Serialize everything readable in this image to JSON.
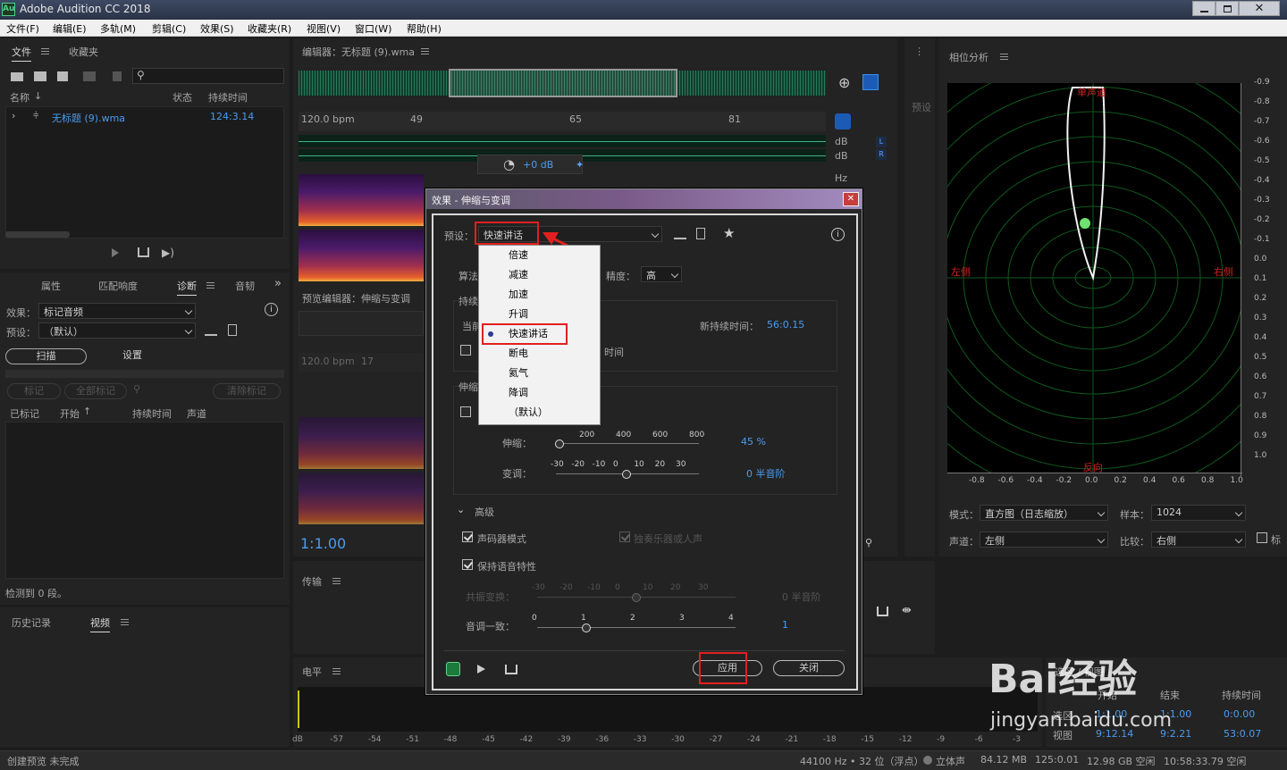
{
  "app": {
    "icon_text": "Au",
    "title": "Adobe Audition CC 2018"
  },
  "menu": [
    "文件(F)",
    "编辑(E)",
    "多轨(M)",
    "剪辑(C)",
    "效果(S)",
    "收藏夹(R)",
    "视图(V)",
    "窗口(W)",
    "帮助(H)"
  ],
  "files_panel": {
    "tab_files": "文件",
    "tab_favorites": "收藏夹",
    "col_name": "名称",
    "col_status": "状态",
    "col_duration": "持续时间",
    "file_name": "无标题 (9).wma",
    "file_duration": "124:3.14"
  },
  "props_panel": {
    "tab_properties": "属性",
    "tab_loudness": "匹配响度",
    "tab_diagnostics": "诊断",
    "tab_audio": "音韧",
    "effect_label": "效果：",
    "effect_value": "标记音频",
    "preset_label": "预设：",
    "preset_value": "（默认）",
    "scan_btn": "扫描",
    "settings_btn": "设置",
    "mark_btn": "标记",
    "mark_all_btn": "全部标记",
    "clear_btn": "清除标记",
    "col_marked": "已标记",
    "col_start": "开始",
    "col_duration": "持续时间",
    "col_channel": "声道",
    "status": "检测到 0 段。"
  },
  "history_panel": {
    "tab_history": "历史记录",
    "tab_video": "视频"
  },
  "editor": {
    "title": "编辑器：无标题 (9).wma",
    "bpm": "120.0 bpm",
    "ruler_marks": [
      "49",
      "65",
      "81"
    ],
    "db1": "dB",
    "db2": "dB",
    "hz": "Hz",
    "ch_l": "L",
    "ch_r": "R",
    "gain": "+0 dB",
    "preview_title": "预览编辑器：伸缩与变调",
    "preview_bpm": "120.0 bpm",
    "preview_mark": "17",
    "time": "1:1.00",
    "preset_side": "预设"
  },
  "transport": {
    "title": "传输"
  },
  "levels": {
    "title": "电平",
    "scale": [
      "dB",
      "-57",
      "-54",
      "-51",
      "-48",
      "-45",
      "-42",
      "-39",
      "-36",
      "-33",
      "-30",
      "-27",
      "-24",
      "-21",
      "-18",
      "-15",
      "-12",
      "-9",
      "-6",
      "-3"
    ]
  },
  "phase": {
    "title": "相位分析",
    "label_top": "单声道",
    "label_left": "左侧",
    "label_right": "右侧",
    "label_bottom": "反向",
    "right_scale": [
      "-0.9",
      "-0.8",
      "-0.7",
      "-0.6",
      "-0.5",
      "-0.4",
      "-0.3",
      "-0.2",
      "-0.1",
      "0.0",
      "0.1",
      "0.2",
      "0.3",
      "0.4",
      "0.5",
      "0.6",
      "0.7",
      "0.8",
      "0.9",
      "1.0"
    ],
    "bottom_scale": [
      "-0.8",
      "-0.6",
      "-0.4",
      "-0.2",
      "0.0",
      "0.2",
      "0.4",
      "0.6",
      "0.8",
      "1.0"
    ],
    "mode_label": "模式：",
    "mode_value": "直方图（日志缩放）",
    "sample_label": "样本：",
    "sample_value": "1024",
    "channel_label": "声道：",
    "channel_value": "左侧",
    "compare_label": "比较：",
    "compare_value": "右侧",
    "cut_label": "标"
  },
  "selection_panel": {
    "title": "选区 / 视图",
    "col_start": "开始",
    "col_end": "结束",
    "col_duration": "持续时间",
    "row1_label": "选区",
    "row1_start": "1:1.00",
    "row1_end": "1:1.00",
    "row1_dur": "0:0.00",
    "row2_label": "视图",
    "row2_start": "9:12.14",
    "row2_end": "9:2.21",
    "row2_dur": "53:0.07"
  },
  "status_bar": {
    "left": "创建预览 未完成",
    "sample_rate": "44100 Hz • 32 位（浮点）",
    "channels": "立体声",
    "size": "84.12 MB",
    "duration": "125:0.01",
    "free": "12.98 GB 空闲",
    "time": "10:58:33.79 空闲"
  },
  "dialog": {
    "title": "效果 - 伸缩与变调",
    "preset_label": "预设：",
    "preset_value": "快速讲话",
    "algo_label": "算法",
    "precision_label": "精度：",
    "precision_value": "高",
    "duration_label": "持续",
    "current_label": "当前",
    "new_duration_label": "新持续时间：",
    "new_duration_value": "56:0.15",
    "lock_text": "时间",
    "stretch_group": "伸缩",
    "stretch_label": "伸缩：",
    "stretch_value": "45 %",
    "stretch_scale": [
      "200",
      "400",
      "600",
      "800"
    ],
    "pitch_label": "变调：",
    "pitch_value": "0 半音阶",
    "pitch_scale": [
      "-30",
      "-20",
      "-10",
      "0",
      "10",
      "20",
      "30"
    ],
    "advanced": "高级",
    "vocoder": "声码器模式",
    "solo": "独奏乐器或人声",
    "preserve": "保持语音特性",
    "formant_label": "共振变换：",
    "formant_value": "0 半音阶",
    "formant_scale": [
      "-30",
      "-20",
      "-10",
      "0",
      "10",
      "20",
      "30"
    ],
    "pitch_coherence_label": "音调一致：",
    "pitch_coherence_value": "1",
    "coherence_scale": [
      "0",
      "1",
      "2",
      "3",
      "4"
    ],
    "apply_btn": "应用",
    "close_btn": "关闭",
    "menu_items": [
      "倍速",
      "减速",
      "加速",
      "升调",
      "快速讲话",
      "断电",
      "氦气",
      "降调",
      "（默认）"
    ]
  },
  "watermark": {
    "brand": "Bai经验",
    "url": "jingyan.baidu.com"
  },
  "colors": {
    "accent": "#2d8ceb",
    "annotation": "#e0201e",
    "phase_grid": "#0f5a1c"
  }
}
